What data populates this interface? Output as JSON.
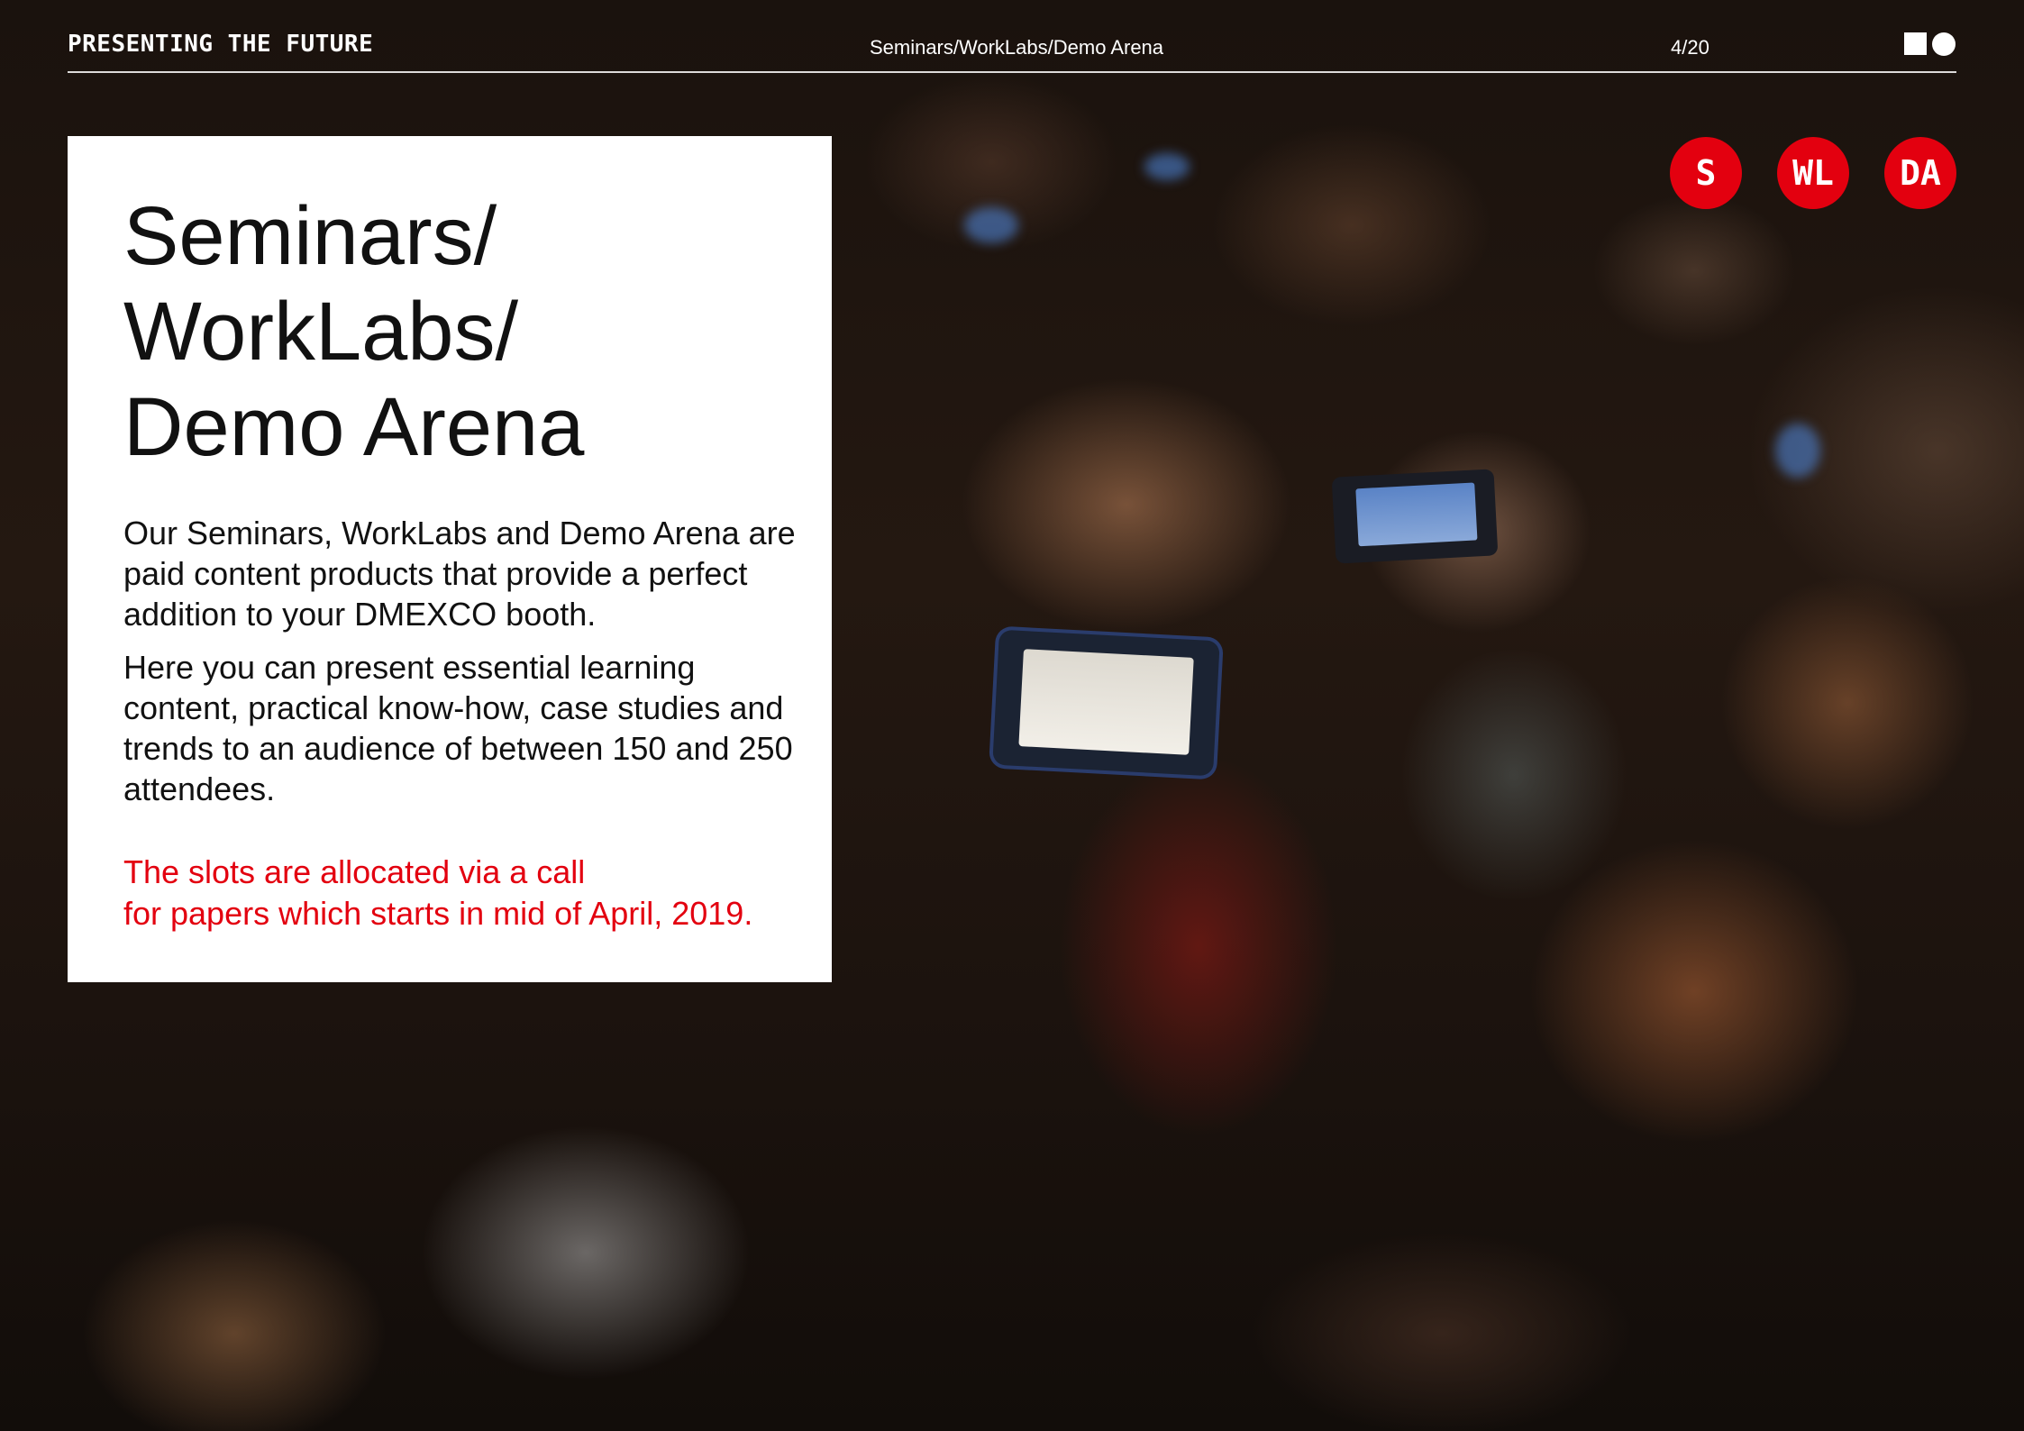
{
  "header": {
    "brand": "PRESENTING THE FUTURE",
    "breadcrumb": "Seminars/WorkLabs/Demo Arena",
    "page_indicator": "4/20"
  },
  "nav_badges": [
    {
      "label": "S"
    },
    {
      "label": "WL"
    },
    {
      "label": "DA"
    }
  ],
  "card": {
    "title_lines": [
      "Seminars/",
      "WorkLabs/",
      "Demo Arena"
    ],
    "paragraphs": [
      "Our Seminars, WorkLabs and Demo Arena are paid content products that provide a perfect addition to your DMEXCO booth.",
      "Here you can present essential learning content, practical know-how, case studies and trends to an audience of between 150 and 250 attendees."
    ],
    "callout_lines": [
      "The slots are allocated via a call",
      "for papers which starts in mid of April, 2019."
    ]
  },
  "colors": {
    "accent_red": "#e3000f",
    "card_background": "#ffffff",
    "text_dark": "#111111"
  },
  "icons": {
    "logo": "square-circle-logo"
  }
}
